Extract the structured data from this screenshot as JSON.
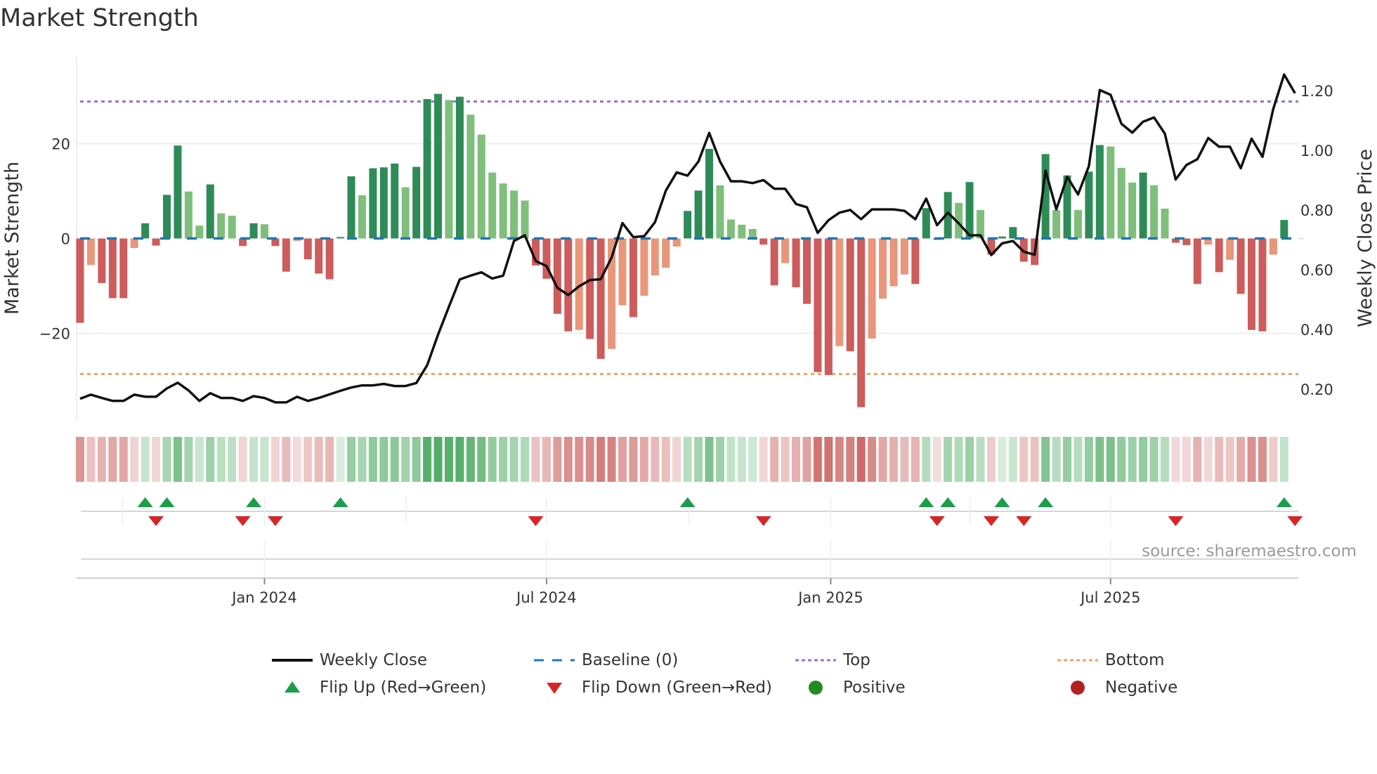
{
  "title": "Market Strength",
  "source": "source: sharemaestro.com",
  "legend": {
    "weekly_close": "Weekly Close",
    "baseline": "Baseline (0)",
    "top": "Top",
    "bottom": "Bottom",
    "flip_up": "Flip Up (Red→Green)",
    "flip_down": "Flip Down (Green→Red)",
    "positive": "Positive",
    "negative": "Negative"
  },
  "colors": {
    "bar_pos_strong": "#2e8b57",
    "bar_pos_weak": "#7fbf7b",
    "bar_neg_strong": "#cd5c5c",
    "bar_neg_weak": "#e9967a",
    "close_line": "#111111",
    "baseline": "#1f77b4",
    "top": "#9a6ee0",
    "bottom": "#f4a261",
    "flip_up": "#1a9e4a",
    "flip_down": "#d62728",
    "positive": "#228b22",
    "negative": "#b22222"
  },
  "chart_data": {
    "type": "bar",
    "title": "Market Strength",
    "ylabel": "Market Strength",
    "y2label": "Weekly Close Price",
    "ylim": [
      -38.3,
      38.3
    ],
    "y2lim": [
      0.096,
      1.313
    ],
    "yticks": [
      {
        "value": 20,
        "label": "20"
      },
      {
        "value": 0,
        "label": "0"
      },
      {
        "value": -20,
        "label": "−20"
      }
    ],
    "y2ticks": [
      {
        "value": 1.2,
        "label": "1.20"
      },
      {
        "value": 1.0,
        "label": "1.00"
      },
      {
        "value": 0.8,
        "label": "0.80"
      },
      {
        "value": 0.6,
        "label": "0.60"
      },
      {
        "value": 0.4,
        "label": "0.40"
      },
      {
        "value": 0.2,
        "label": "0.20"
      }
    ],
    "xticks": [
      {
        "week": 18.0,
        "label": "Jan 2024"
      },
      {
        "week": 44.0,
        "label": "Jul 2024"
      },
      {
        "week": 70.2,
        "label": "Jan 2025"
      },
      {
        "week": 96.0,
        "label": "Jul 2025"
      }
    ],
    "minor_ticks_week": [
      4.9,
      31.05,
      57.15,
      83.06
    ],
    "top_level": 28.9,
    "bottom_level": -28.6,
    "baseline": 0,
    "strength": [
      -17.8,
      -5.6,
      -9.4,
      -12.6,
      -12.6,
      -2.0,
      3.2,
      -1.5,
      9.2,
      19.6,
      9.9,
      2.7,
      11.4,
      5.3,
      4.8,
      -1.6,
      3.2,
      3.0,
      -1.6,
      -7.0,
      -0.5,
      -4.4,
      -7.4,
      -8.6,
      0.3,
      13.1,
      9.1,
      14.8,
      15.0,
      15.8,
      10.8,
      15.1,
      29.4,
      30.5,
      29.2,
      29.9,
      26.1,
      21.9,
      13.9,
      11.6,
      10.1,
      8.0,
      -5.7,
      -8.5,
      -15.9,
      -19.6,
      -19.3,
      -21.2,
      -25.4,
      -23.3,
      -14.1,
      -16.6,
      -12.1,
      -7.8,
      -6.2,
      -1.7,
      5.8,
      10.1,
      18.9,
      11.2,
      4.0,
      2.9,
      2.0,
      -1.3,
      -9.9,
      -5.2,
      -10.3,
      -13.8,
      -28.2,
      -28.8,
      -22.7,
      -23.8,
      -35.6,
      -21.1,
      -12.7,
      -10.1,
      -7.6,
      -9.6,
      6.4,
      -0.3,
      9.8,
      7.5,
      11.9,
      6.0,
      -3.4,
      0.4,
      2.4,
      -4.9,
      -5.6,
      17.8,
      6.0,
      13.3,
      6.0,
      14.1,
      19.7,
      19.4,
      14.9,
      11.8,
      13.9,
      11.2,
      6.3,
      -0.9,
      -1.4,
      -9.6,
      -1.3,
      -7.1,
      -4.5,
      -11.7,
      -19.3,
      -19.6,
      -3.4,
      3.9
    ],
    "weekly_close": [
      0.167,
      0.181,
      0.17,
      0.16,
      0.16,
      0.181,
      0.174,
      0.174,
      0.202,
      0.221,
      0.195,
      0.16,
      0.186,
      0.17,
      0.17,
      0.16,
      0.176,
      0.17,
      0.155,
      0.155,
      0.174,
      0.16,
      0.17,
      0.182,
      0.194,
      0.205,
      0.212,
      0.212,
      0.217,
      0.21,
      0.21,
      0.22,
      0.28,
      0.382,
      0.476,
      0.567,
      0.58,
      0.591,
      0.57,
      0.58,
      0.696,
      0.715,
      0.629,
      0.612,
      0.539,
      0.515,
      0.544,
      0.565,
      0.568,
      0.641,
      0.756,
      0.709,
      0.712,
      0.759,
      0.865,
      0.926,
      0.915,
      0.962,
      1.058,
      0.962,
      0.896,
      0.896,
      0.89,
      0.9,
      0.871,
      0.871,
      0.82,
      0.809,
      0.723,
      0.766,
      0.791,
      0.8,
      0.769,
      0.802,
      0.802,
      0.802,
      0.797,
      0.769,
      0.838,
      0.749,
      0.791,
      0.755,
      0.715,
      0.715,
      0.649,
      0.688,
      0.696,
      0.66,
      0.65,
      0.932,
      0.802,
      0.911,
      0.852,
      0.947,
      1.202,
      1.186,
      1.089,
      1.059,
      1.096,
      1.11,
      1.056,
      0.902,
      0.951,
      0.97,
      1.041,
      1.012,
      1.012,
      0.94,
      1.039,
      0.978,
      1.139,
      1.254,
      1.191
    ],
    "flip_up_weeks": [
      7,
      9,
      17,
      25,
      57,
      79,
      81,
      86,
      90,
      112
    ],
    "flip_down_weeks": [
      8,
      16,
      19,
      43,
      64,
      80,
      85,
      88,
      102,
      113
    ],
    "legend_position": "bottom"
  }
}
